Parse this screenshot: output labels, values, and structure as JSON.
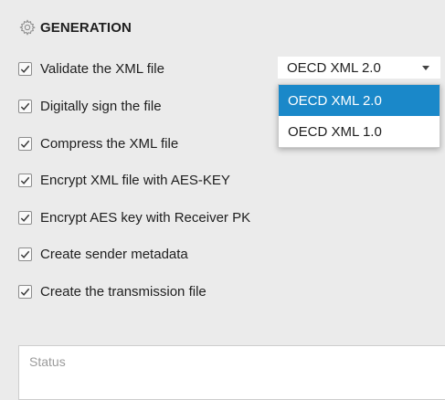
{
  "section": {
    "title": "GENERATION",
    "icon": "gear-icon"
  },
  "options": [
    {
      "label": "Validate the XML file",
      "checked": true
    },
    {
      "label": "Digitally sign the file",
      "checked": true
    },
    {
      "label": "Compress the XML file",
      "checked": true
    },
    {
      "label": "Encrypt XML file with AES-KEY",
      "checked": true
    },
    {
      "label": "Encrypt AES key with Receiver PK",
      "checked": true
    },
    {
      "label": "Create sender metadata",
      "checked": true
    },
    {
      "label": "Create the transmission file",
      "checked": true
    }
  ],
  "schema_select": {
    "value": "OECD XML 2.0",
    "options": [
      "OECD XML 2.0",
      "OECD XML 1.0"
    ],
    "highlighted": "OECD XML 2.0"
  },
  "status": {
    "placeholder": "Status",
    "value": ""
  },
  "colors": {
    "background": "#ebebeb",
    "accent": "#1a88c9",
    "text": "#202020"
  }
}
